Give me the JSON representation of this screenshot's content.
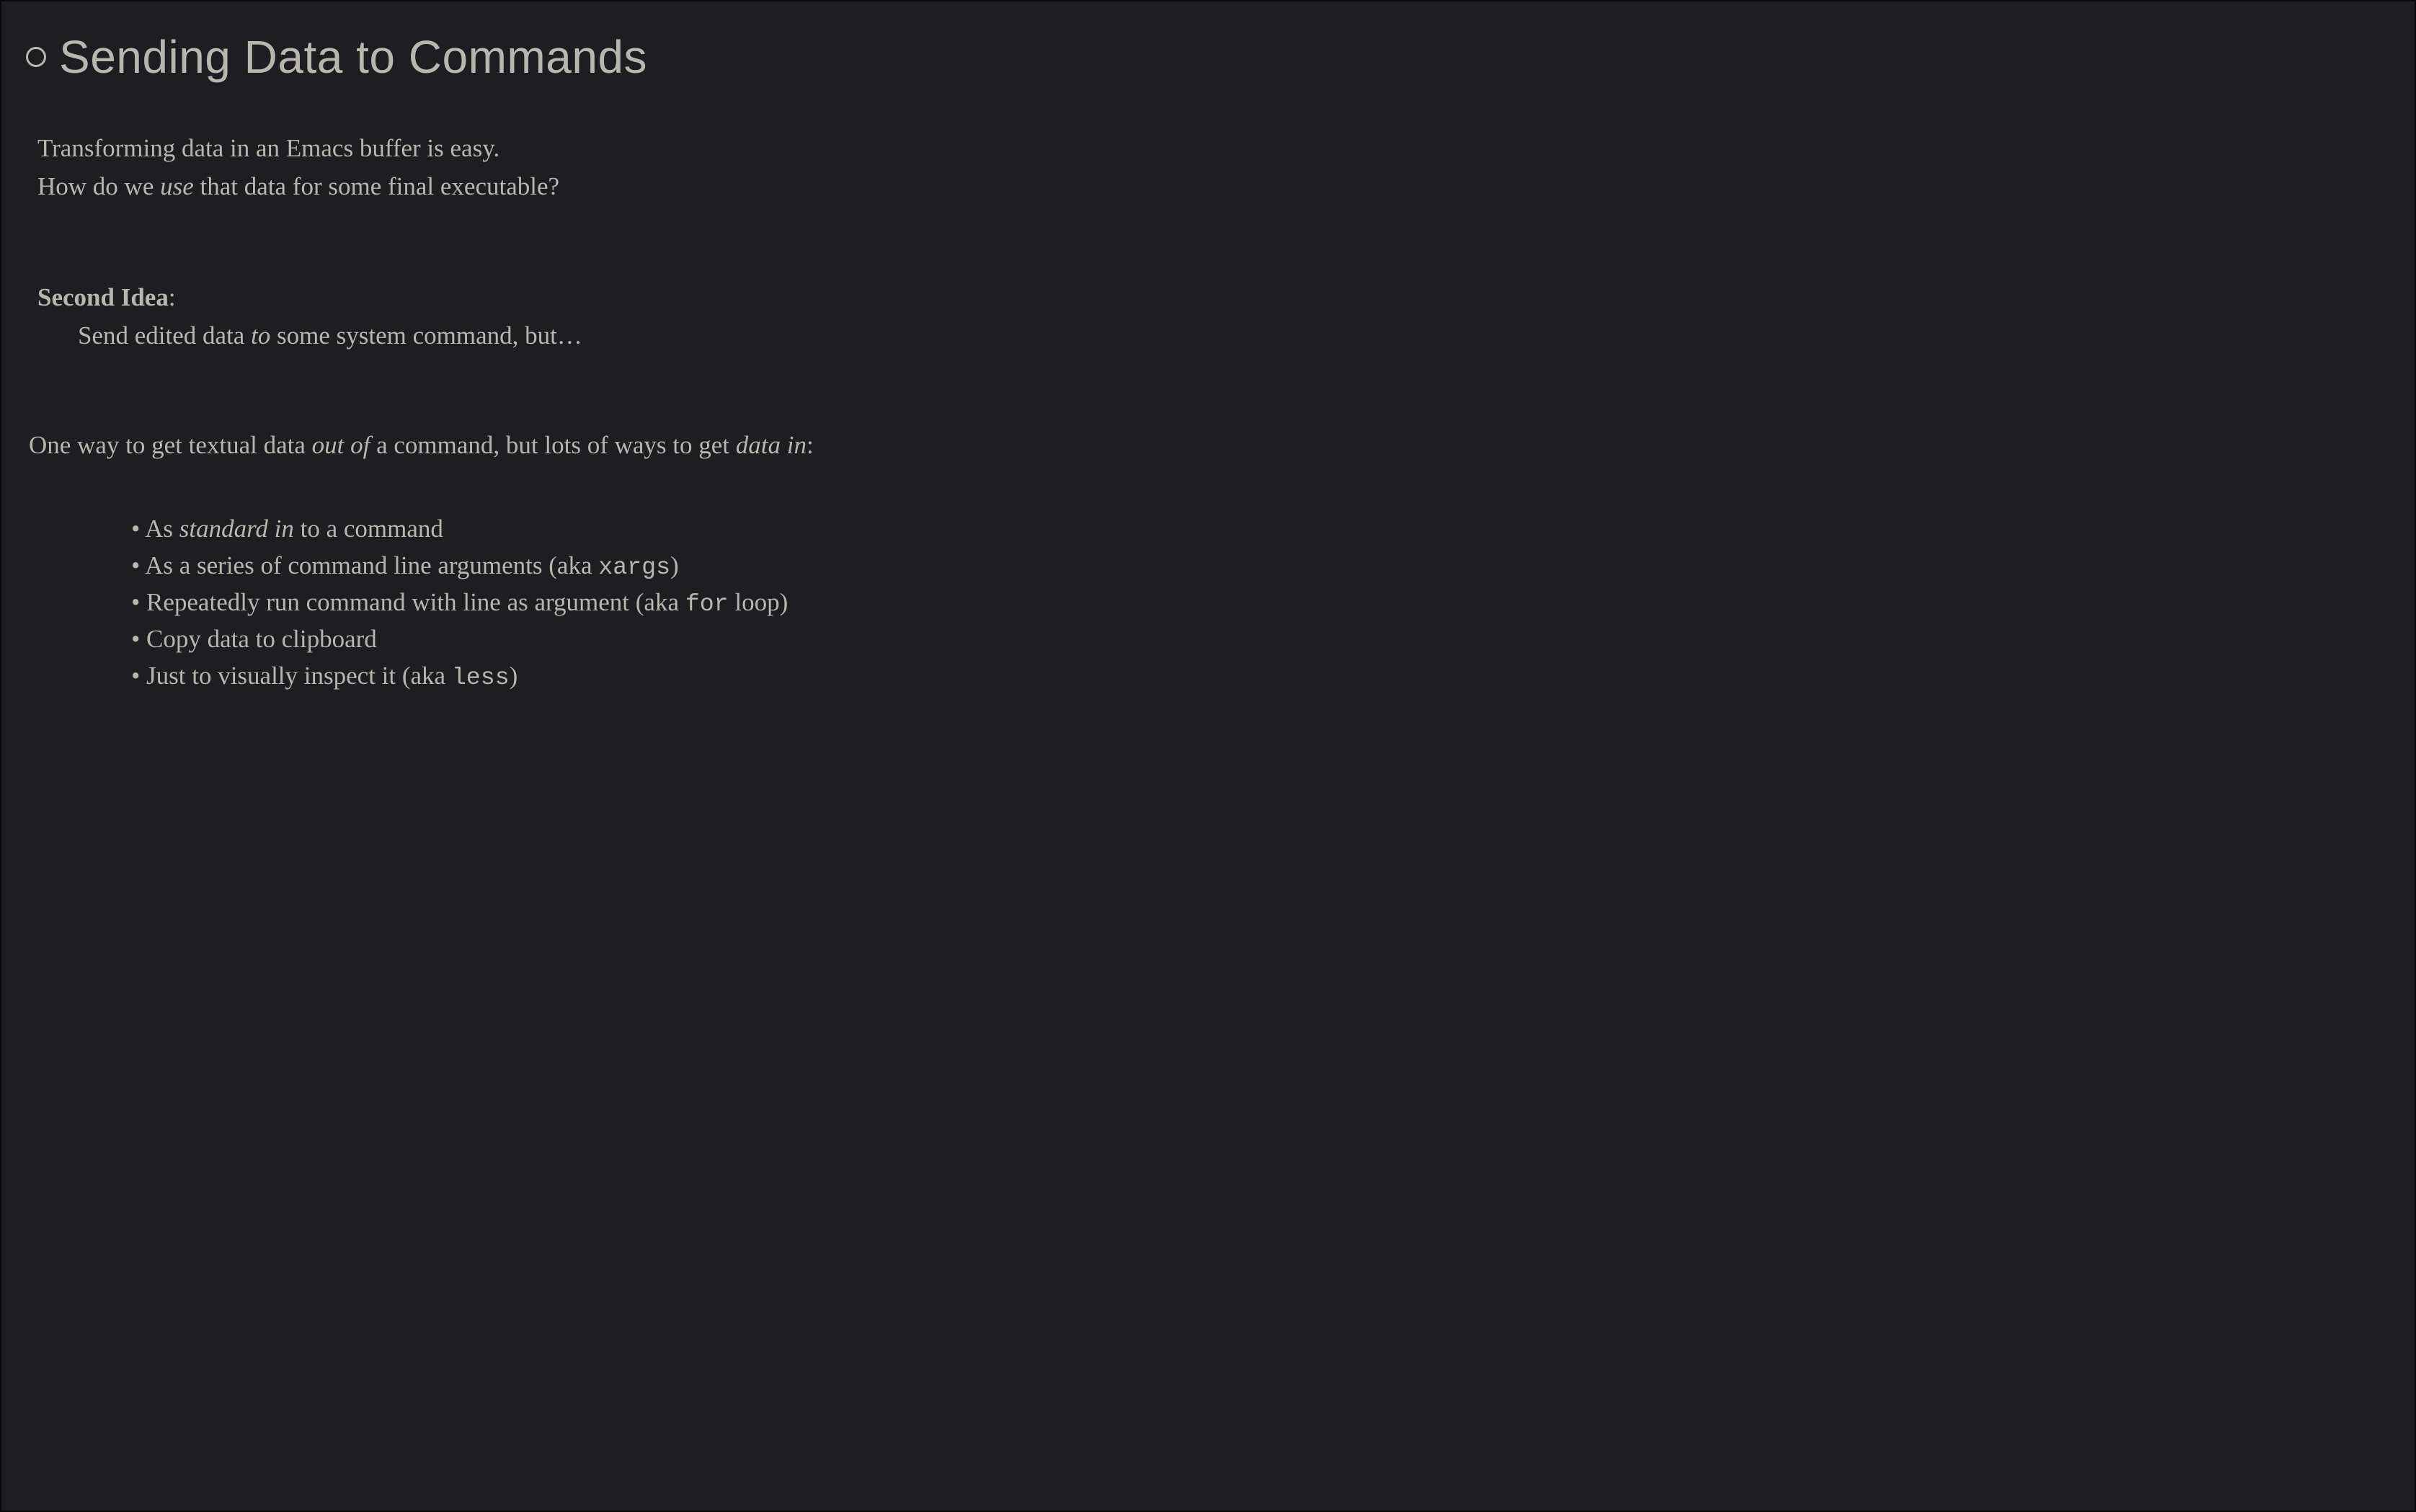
{
  "heading": "Sending Data to Commands",
  "intro": {
    "line1": "Transforming data in an Emacs buffer is easy.",
    "line2_pre": "How do we ",
    "line2_em": "use",
    "line2_post": " that data for some final executable?"
  },
  "idea": {
    "label": "Second Idea",
    "colon": ":",
    "body_pre": "Send edited data ",
    "body_em": "to",
    "body_post": " some system command, but…"
  },
  "transition": {
    "pre": "One way to get textual data ",
    "em1": "out of",
    "mid": " a command, but lots of ways to get ",
    "em2": "data in",
    "post": ":"
  },
  "bullets": [
    {
      "pre": "As ",
      "em": "standard in",
      "mid": " to a command",
      "code": "",
      "post": ""
    },
    {
      "pre": "As a series of command line arguments (aka ",
      "em": "",
      "mid": "",
      "code": "xargs",
      "post": ")"
    },
    {
      "pre": "Repeatedly run command with line as argument (aka ",
      "em": "",
      "mid": "",
      "code": "for",
      "post": " loop)"
    },
    {
      "pre": "Copy data to clipboard",
      "em": "",
      "mid": "",
      "code": "",
      "post": ""
    },
    {
      "pre": "Just to visually inspect it (aka ",
      "em": "",
      "mid": "",
      "code": "less",
      "post": ")"
    }
  ]
}
